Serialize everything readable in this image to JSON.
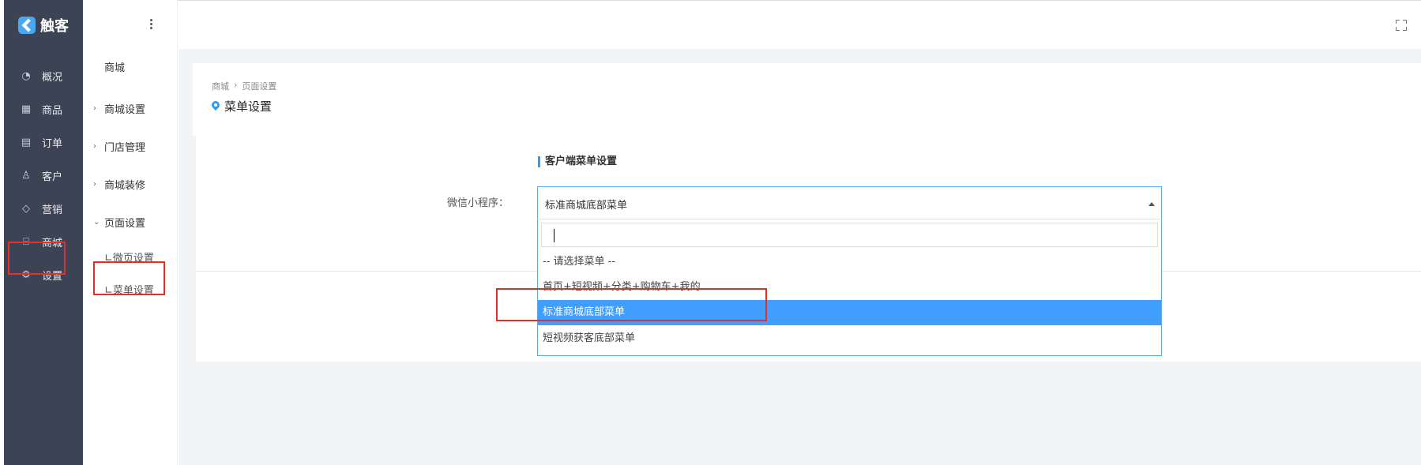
{
  "app": {
    "name": "触客"
  },
  "main_nav": [
    {
      "label": "概况",
      "icon": "gauge-icon"
    },
    {
      "label": "商品",
      "icon": "grid-icon"
    },
    {
      "label": "订单",
      "icon": "calendar-icon"
    },
    {
      "label": "客户",
      "icon": "user-icon"
    },
    {
      "label": "营销",
      "icon": "tag-icon"
    },
    {
      "label": "商城",
      "icon": "shop-icon"
    },
    {
      "label": "设置",
      "icon": "gear-icon"
    }
  ],
  "sub_nav": {
    "header": "商城",
    "groups": [
      {
        "label": "商城设置",
        "expanded": false
      },
      {
        "label": "门店管理",
        "expanded": false
      },
      {
        "label": "商城装修",
        "expanded": false
      },
      {
        "label": "页面设置",
        "expanded": true
      }
    ],
    "children": [
      {
        "label": "∟微页设置"
      },
      {
        "label": "∟菜单设置"
      }
    ]
  },
  "breadcrumb": [
    "商城",
    "页面设置"
  ],
  "page_title": "菜单设置",
  "form": {
    "section_title": "客户端菜单设置",
    "label": "微信小程序：",
    "selected_value": "标准商城底部菜单",
    "search_value": "",
    "options": [
      {
        "label": "-- 请选择菜单 --",
        "active": false
      },
      {
        "label": "首页+短视频+分类+购物车+我的",
        "active": false
      },
      {
        "label": "标准商城底部菜单",
        "active": true
      },
      {
        "label": "短视频获客底部菜单",
        "active": false
      }
    ]
  },
  "colors": {
    "sidebar_bg": "#3b4354",
    "accent": "#409eff",
    "annotation_red": "#e0302a"
  }
}
